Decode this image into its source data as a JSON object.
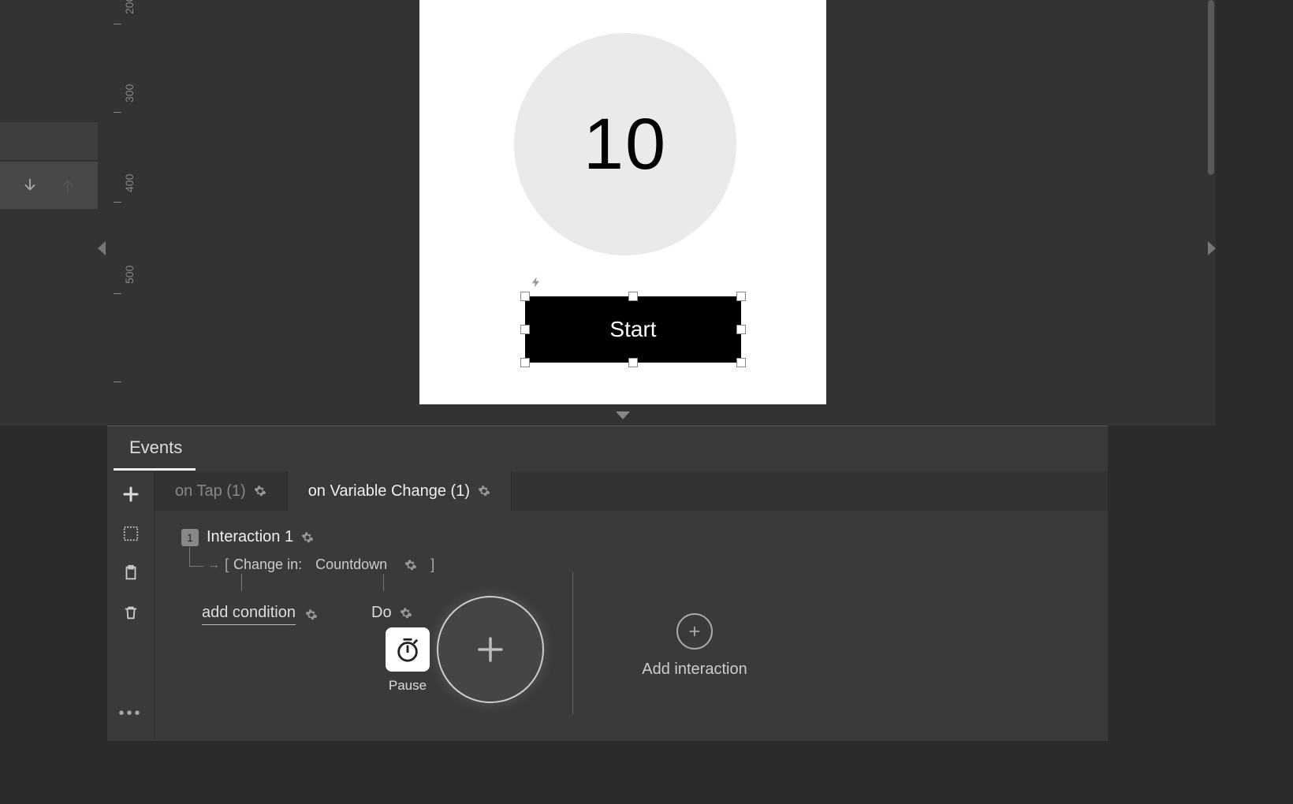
{
  "ruler": {
    "ticks": [
      "200",
      "300",
      "400",
      "500"
    ]
  },
  "canvas": {
    "counter_value": "10",
    "start_button_label": "Start",
    "interaction_indicator": "⚡"
  },
  "events": {
    "panel_title": "Events",
    "tabs": [
      {
        "label": "on Tap (1)"
      },
      {
        "label": "on Variable Change (1)"
      }
    ],
    "interaction": {
      "badge": "1",
      "name": "Interaction 1",
      "trigger_prefix": "Change in:",
      "trigger_var": "Countdown"
    },
    "add_condition_label": "add condition",
    "do_label": "Do",
    "pause_label": "Pause",
    "add_interaction_label": "Add interaction"
  },
  "icons": {
    "plus": "plus-icon",
    "layout": "layout-icon",
    "clipboard": "clipboard-icon",
    "trash": "trash-icon",
    "more": "more-icon",
    "gear": "gear-icon",
    "arrow_down": "arrow-down-icon",
    "arrow_up": "arrow-up-icon",
    "stopwatch": "stopwatch-icon"
  }
}
